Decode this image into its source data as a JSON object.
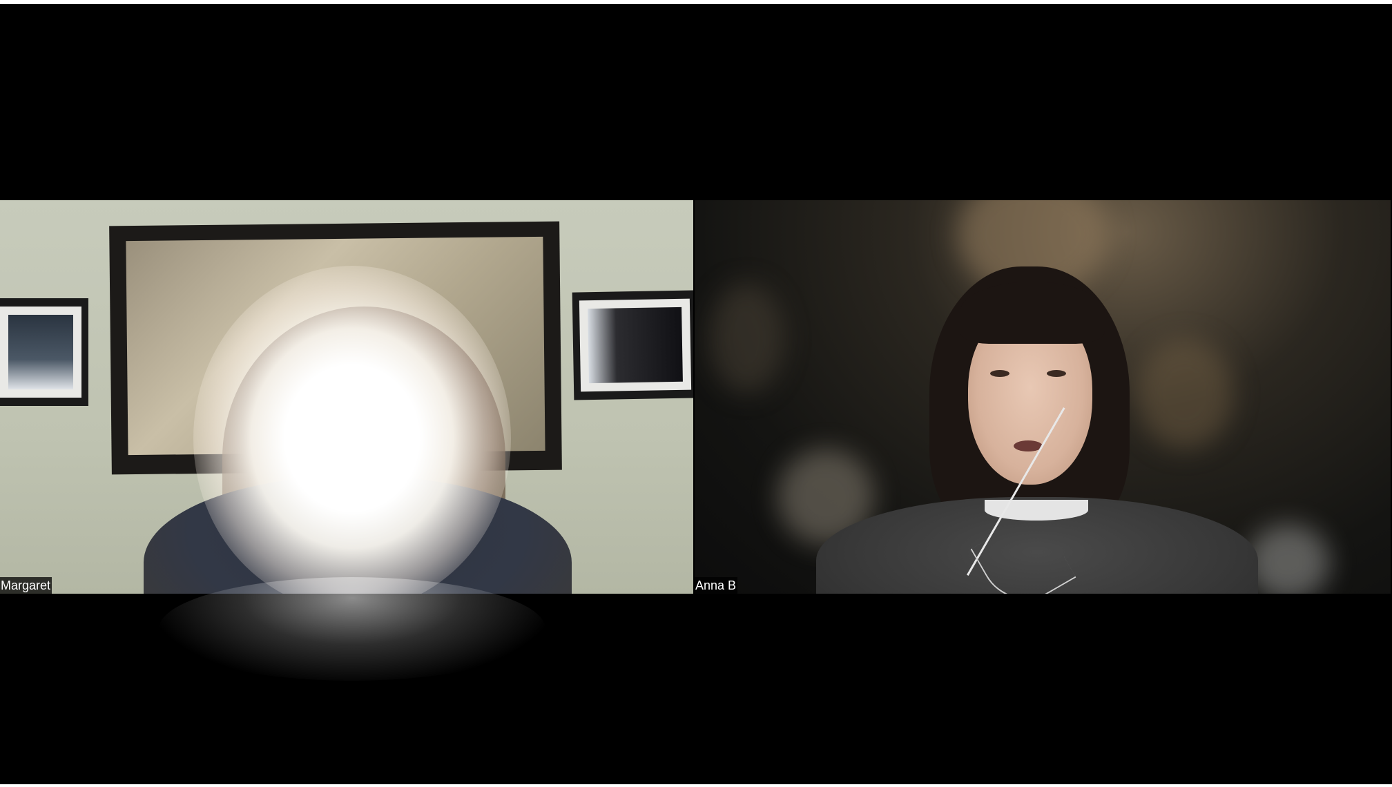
{
  "meeting": {
    "participants": [
      {
        "name": "Margaret"
      },
      {
        "name": "Anna B"
      }
    ]
  }
}
